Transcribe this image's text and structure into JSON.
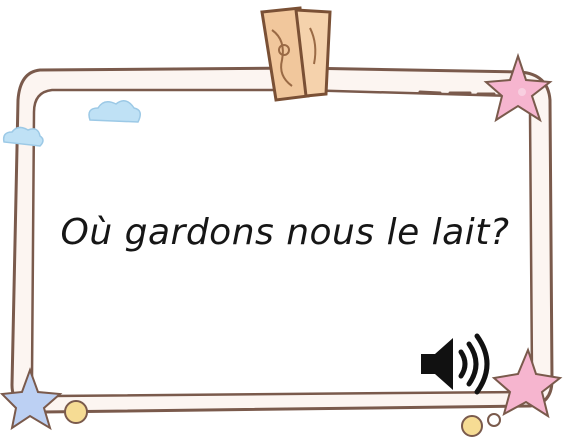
{
  "card": {
    "question": "Où gardons nous le lait?"
  },
  "icons": {
    "audio": "speaker-volume-icon",
    "clip": "wooden-clip-icon",
    "stars": "star-icon",
    "clouds": "cloud-icon",
    "dots": "dot-icon"
  },
  "colors": {
    "frame_outline": "#7a5a4c",
    "frame_fill": "#fbf3ee",
    "clip_fill": "#f3c79a",
    "clip_outline": "#7a5035",
    "star_pink": "#f6b5cf",
    "star_blue": "#bcd0f3",
    "cloud_blue": "#bfe1f5",
    "dot_yellow": "#f6dc94",
    "text": "#161616"
  }
}
